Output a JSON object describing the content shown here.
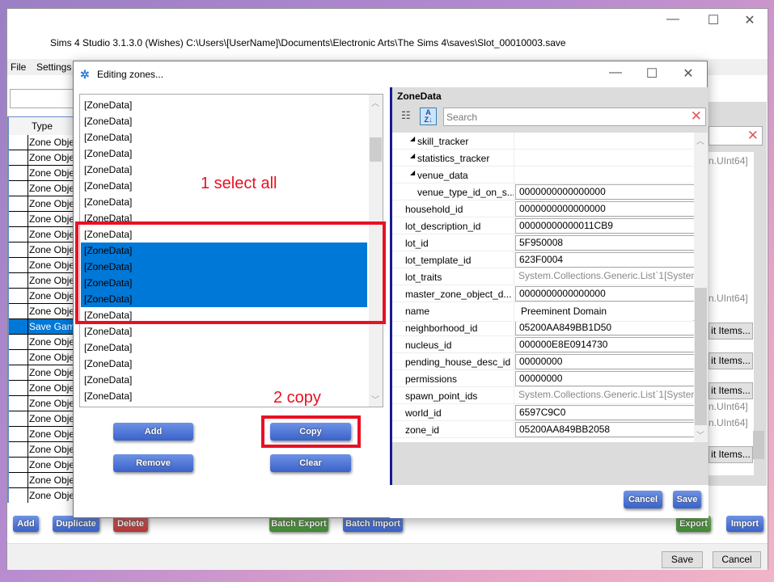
{
  "main_window": {
    "title": "Sims 4 Studio 3.1.3.0 (Wishes)  C:\\Users\\[UserName]\\Documents\\Electronic Arts\\The Sims 4\\saves\\Slot_00010003.save",
    "controls": {
      "minimize": "—",
      "maximize": "☐",
      "close": "✕"
    },
    "menu": [
      "File",
      "Settings"
    ],
    "grid": {
      "header": "Type",
      "rows": [
        "Zone Obje",
        "Zone Obje",
        "Zone Obje",
        "Zone Obje",
        "Zone Obje",
        "Zone Obje",
        "Zone Obje",
        "Zone Obje",
        "Zone Obje",
        "Zone Obje",
        "Zone Obje",
        "Zone Obje",
        "Save Game",
        "Zone Obje",
        "Zone Obje",
        "Zone Obje",
        "Zone Obje",
        "Zone Obje",
        "Zone Obje",
        "Zone Obje",
        "Zone Obje",
        "Zone Obje",
        "Zone Obje",
        "Zone Obje"
      ],
      "selected_index": 12
    },
    "right_panel": {
      "uint_text": "n.UInt64]",
      "edit_items": "it Items..."
    },
    "buttons": {
      "add": "Add",
      "duplicate": "Duplicate",
      "delete": "Delete",
      "batch_export": "Batch Export",
      "batch_import": "Batch Import",
      "export": "Export",
      "import": "Import",
      "save": "Save",
      "cancel": "Cancel"
    }
  },
  "dialog": {
    "title": "Editing zones...",
    "controls": {
      "minimize": "—",
      "maximize": "☐",
      "close": "✕"
    },
    "list_items": [
      "[ZoneData]",
      "[ZoneData]",
      "[ZoneData]",
      "[ZoneData]",
      "[ZoneData]",
      "[ZoneData]",
      "[ZoneData]",
      "[ZoneData]",
      "[ZoneData]",
      "[ZoneData]",
      "[ZoneData]",
      "[ZoneData]",
      "[ZoneData]",
      "[ZoneData]",
      "[ZoneData]",
      "[ZoneData]",
      "[ZoneData]",
      "[ZoneData]",
      "[ZoneData]"
    ],
    "selected_indices": [
      9,
      10,
      11,
      12
    ],
    "annotations": {
      "step1": "1   select all",
      "step2": "2   copy"
    },
    "buttons": {
      "add": "Add",
      "copy": "Copy",
      "remove": "Remove",
      "clear": "Clear",
      "cancel": "Cancel",
      "save": "Save"
    },
    "property_grid": {
      "header": "ZoneData",
      "search_placeholder": "Search",
      "rows": [
        {
          "key": "skill_tracker",
          "value": "",
          "type": "group"
        },
        {
          "key": "statistics_tracker",
          "value": "",
          "type": "group"
        },
        {
          "key": "venue_data",
          "value": "",
          "type": "group"
        },
        {
          "key": "venue_type_id_on_s...",
          "value": "0000000000000000",
          "type": "child"
        },
        {
          "key": "household_id",
          "value": "0000000000000000",
          "type": "edit"
        },
        {
          "key": "lot_description_id",
          "value": "00000000000011CB9",
          "type": "edit"
        },
        {
          "key": "lot_id",
          "value": "5F950008",
          "type": "edit"
        },
        {
          "key": "lot_template_id",
          "value": "623F0004",
          "type": "edit"
        },
        {
          "key": "lot_traits",
          "value": "System.Collections.Generic.List`1[System.UInt64]",
          "type": "ro"
        },
        {
          "key": "master_zone_object_d...",
          "value": "0000000000000000",
          "type": "edit"
        },
        {
          "key": "name",
          "value": "Preeminent Domain",
          "type": "plain"
        },
        {
          "key": "neighborhood_id",
          "value": "05200AA849BB1D50",
          "type": "edit"
        },
        {
          "key": "nucleus_id",
          "value": "000000E8E0914730",
          "type": "edit"
        },
        {
          "key": "pending_house_desc_id",
          "value": "00000000",
          "type": "edit"
        },
        {
          "key": "permissions",
          "value": "00000000",
          "type": "edit"
        },
        {
          "key": "spawn_point_ids",
          "value": "System.Collections.Generic.List`1[System.UInt64]",
          "type": "ro"
        },
        {
          "key": "world_id",
          "value": "6597C9C0",
          "type": "edit"
        },
        {
          "key": "zone_id",
          "value": "05200AA849BB2058",
          "type": "edit"
        }
      ]
    }
  },
  "colors": {
    "selection": "#0078d7",
    "annotation": "#e81123",
    "button_blue": "#3a62c9",
    "button_green": "#3f8a34",
    "button_red": "#b53535"
  }
}
